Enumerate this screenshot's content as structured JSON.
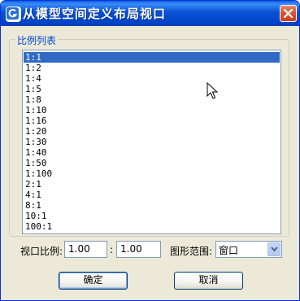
{
  "window": {
    "title": "从模型空间定义布局视口",
    "app_icon": "app-g-icon",
    "close_icon": "close-icon"
  },
  "scale_group": {
    "label": "比例列表",
    "items": [
      "1:1",
      "1:2",
      "1:4",
      "1:5",
      "1:8",
      "1:10",
      "1:16",
      "1:20",
      "1:30",
      "1:40",
      "1:50",
      "1:100",
      "2:1",
      "4:1",
      "8:1",
      "10:1",
      "100:1"
    ],
    "selected": "1:1"
  },
  "viewport_scale": {
    "label": "视口比例:",
    "value1": "1.00",
    "separator": ":",
    "value2": "1.00"
  },
  "shape_range": {
    "label": "图形范围:",
    "selected": "窗口",
    "arrow_icon": "chevron-down-icon"
  },
  "buttons": {
    "ok": "确定",
    "cancel": "取消"
  },
  "colors": {
    "title_bar": "#0852d6",
    "selection": "#316ac5",
    "group_label": "#0046d5",
    "close_button": "#d9542c"
  }
}
